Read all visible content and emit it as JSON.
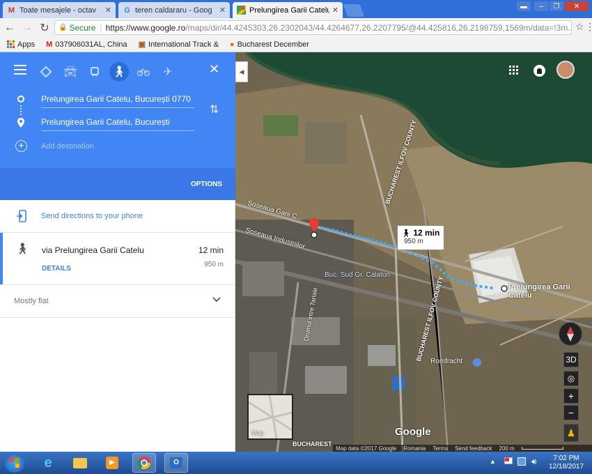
{
  "browser": {
    "tabs": [
      {
        "title": "Toate mesajele - octavă",
        "favicon": "M",
        "active": false
      },
      {
        "title": "teren caldararu - Google",
        "favicon": "G",
        "active": false
      },
      {
        "title": "Prelungirea Garii Catelu",
        "favicon": "maps",
        "active": true
      }
    ],
    "security_label": "Secure",
    "url_host": "https://www.google.ro",
    "url_path": "/maps/dir/44.4245303,26.2302043/44.4264677,26.2207795/@44.425816,26.2198759,1569m/data=!3m...",
    "bookmarks": [
      {
        "label": "Apps",
        "icon": "apps-grid"
      },
      {
        "label": "037906031AL, China",
        "icon": "red-m"
      },
      {
        "label": "International Track &",
        "icon": "package"
      },
      {
        "label": "Bucharest December",
        "icon": "orange-circle"
      }
    ]
  },
  "directions": {
    "origin": "Prelungirea Garii Catelu, București 0770",
    "destination": "Prelungirea Garii Catelu, București",
    "add_destination_placeholder": "Add destination",
    "options_label": "OPTIONS",
    "send_to_phone": "Send directions to your phone",
    "route": {
      "via": "via Prelungirea Garii Catelu",
      "duration": "12 min",
      "distance": "950 m",
      "details_label": "DETAILS"
    },
    "elevation_note": "Mostly flat"
  },
  "map": {
    "route_time_label": "12 min",
    "route_distance_label": "950 m",
    "destination_label": "Prelungirea Garii Catelu",
    "labels": {
      "road_garii": "Șoseaua Garii C...",
      "road_industriilor": "Șoseaua Industriilor",
      "station": "Buc. Sud Gr. Calatori",
      "county_a": "BUCHAREST ILFOV COUNTY",
      "county_b": "BUCHAREST ILFOV COUNTY",
      "county_c": "BUCHAREST",
      "street_tarlale": "Drumul intre Tarlale",
      "poi": "Romfracht"
    },
    "buttons": {
      "three_d": "3D",
      "zoom_in": "+",
      "zoom_out": "−",
      "minimap_label": "Map"
    },
    "footer": {
      "google": "Google",
      "attribution": "Map data ©2017 Google",
      "country": "Romania",
      "terms": "Terms",
      "feedback": "Send feedback",
      "scale": "200 m"
    }
  },
  "taskbar": {
    "time": "7:02 PM",
    "date": "12/18/2017"
  },
  "colors": {
    "maps_blue": "#4285f4",
    "route_dots": "#4aa8f0",
    "link_blue": "#3e82e0",
    "pin_red": "#e43d31",
    "tab_bar": "#2f6fd8"
  }
}
